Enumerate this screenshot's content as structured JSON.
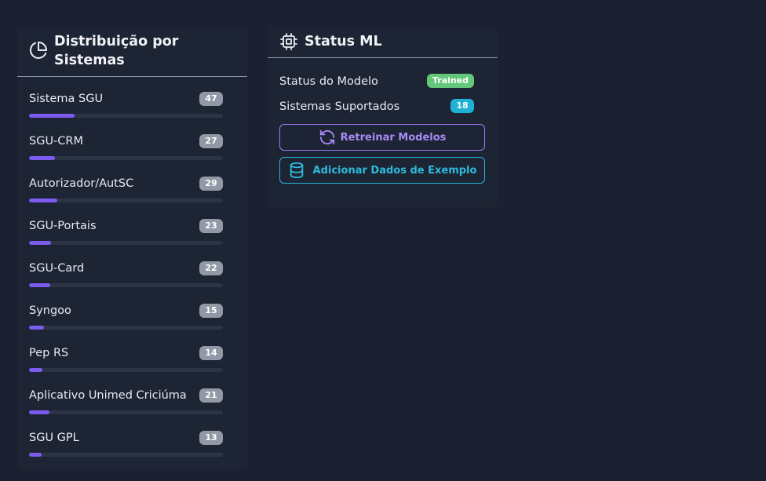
{
  "distribution": {
    "title_line1": "Distribuição por",
    "title_line2": "Sistemas",
    "icon": "pie-chart-icon",
    "max_value": 200,
    "items": [
      {
        "name": "Sistema SGU",
        "count": "47",
        "value": 47
      },
      {
        "name": "SGU-CRM",
        "count": "27",
        "value": 27
      },
      {
        "name": "Autorizador/AutSC",
        "count": "29",
        "value": 29
      },
      {
        "name": "SGU-Portais",
        "count": "23",
        "value": 23
      },
      {
        "name": "SGU-Card",
        "count": "22",
        "value": 22
      },
      {
        "name": "Syngoo",
        "count": "15",
        "value": 15
      },
      {
        "name": "Pep RS",
        "count": "14",
        "value": 14
      },
      {
        "name": "Aplicativo Unimed Criciúma",
        "count": "21",
        "value": 21
      },
      {
        "name": "SGU GPL",
        "count": "13",
        "value": 13
      }
    ],
    "bar_color": "#7c5cf0"
  },
  "ml_status": {
    "title": "Status ML",
    "icon": "cpu-chip-icon",
    "model_status_label": "Status do Modelo",
    "model_status_value": "Trained",
    "systems_supported_label": "Sistemas Suportados",
    "systems_supported_value": "18",
    "retrain_button": "Retreinar Modelos",
    "retrain_icon": "refresh-icon",
    "sample_button": "Adicionar Dados de Exemplo",
    "sample_icon": "database-icon"
  },
  "colors": {
    "background": "#1b2130",
    "accent_purple": "#9b7cf5",
    "accent_cyan": "#26b6d6",
    "status_green": "#64c87c"
  }
}
